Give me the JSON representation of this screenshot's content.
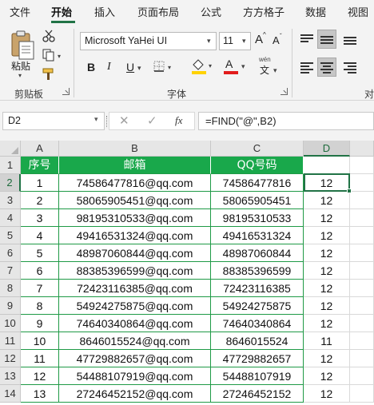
{
  "menu": {
    "items": [
      "文件",
      "开始",
      "插入",
      "页面布局",
      "公式",
      "方方格子",
      "数据",
      "视图"
    ],
    "active_index": 1
  },
  "ribbon": {
    "clipboard": {
      "paste_label": "粘贴",
      "group_label": "剪贴板"
    },
    "font": {
      "font_name": "Microsoft YaHei UI",
      "font_size": "11",
      "grow_label": "A",
      "shrink_label": "A",
      "bold_label": "B",
      "italic_label": "I",
      "underline_label": "U",
      "font_color_label": "A",
      "phonetic_label": "wén",
      "phonetic_sub": "文",
      "group_label": "字体",
      "fill_color": "#ffd200",
      "font_color": "#e11c1c"
    },
    "alignment": {
      "group_label": "对"
    }
  },
  "formula_bar": {
    "name_box": "D2",
    "fx_label": "fx",
    "formula": "=FIND(\"@\",B2)"
  },
  "sheet": {
    "columns": [
      "A",
      "B",
      "C",
      "D"
    ],
    "header_row": [
      "序号",
      "邮箱",
      "QQ号码",
      ""
    ],
    "rows": [
      [
        "1",
        "74586477816@qq.com",
        "74586477816",
        "12"
      ],
      [
        "2",
        "58065905451@qq.com",
        "58065905451",
        "12"
      ],
      [
        "3",
        "98195310533@qq.com",
        "98195310533",
        "12"
      ],
      [
        "4",
        "49416531324@qq.com",
        "49416531324",
        "12"
      ],
      [
        "5",
        "48987060844@qq.com",
        "48987060844",
        "12"
      ],
      [
        "6",
        "88385396599@qq.com",
        "88385396599",
        "12"
      ],
      [
        "7",
        "72423116385@qq.com",
        "72423116385",
        "12"
      ],
      [
        "8",
        "54924275875@qq.com",
        "54924275875",
        "12"
      ],
      [
        "9",
        "74640340864@qq.com",
        "74640340864",
        "12"
      ],
      [
        "10",
        "8646015524@qq.com",
        "8646015524",
        "11"
      ],
      [
        "11",
        "47729882657@qq.com",
        "47729882657",
        "12"
      ],
      [
        "12",
        "54488107919@qq.com",
        "54488107919",
        "12"
      ],
      [
        "13",
        "27246452152@qq.com",
        "27246452152",
        "12"
      ]
    ],
    "row_numbers": [
      "1",
      "2",
      "3",
      "4",
      "5",
      "6",
      "7",
      "8",
      "9",
      "10",
      "11",
      "12",
      "13",
      "14"
    ],
    "active_cell": "D2",
    "header_color": "#19a84b",
    "accent_color": "#217346"
  }
}
